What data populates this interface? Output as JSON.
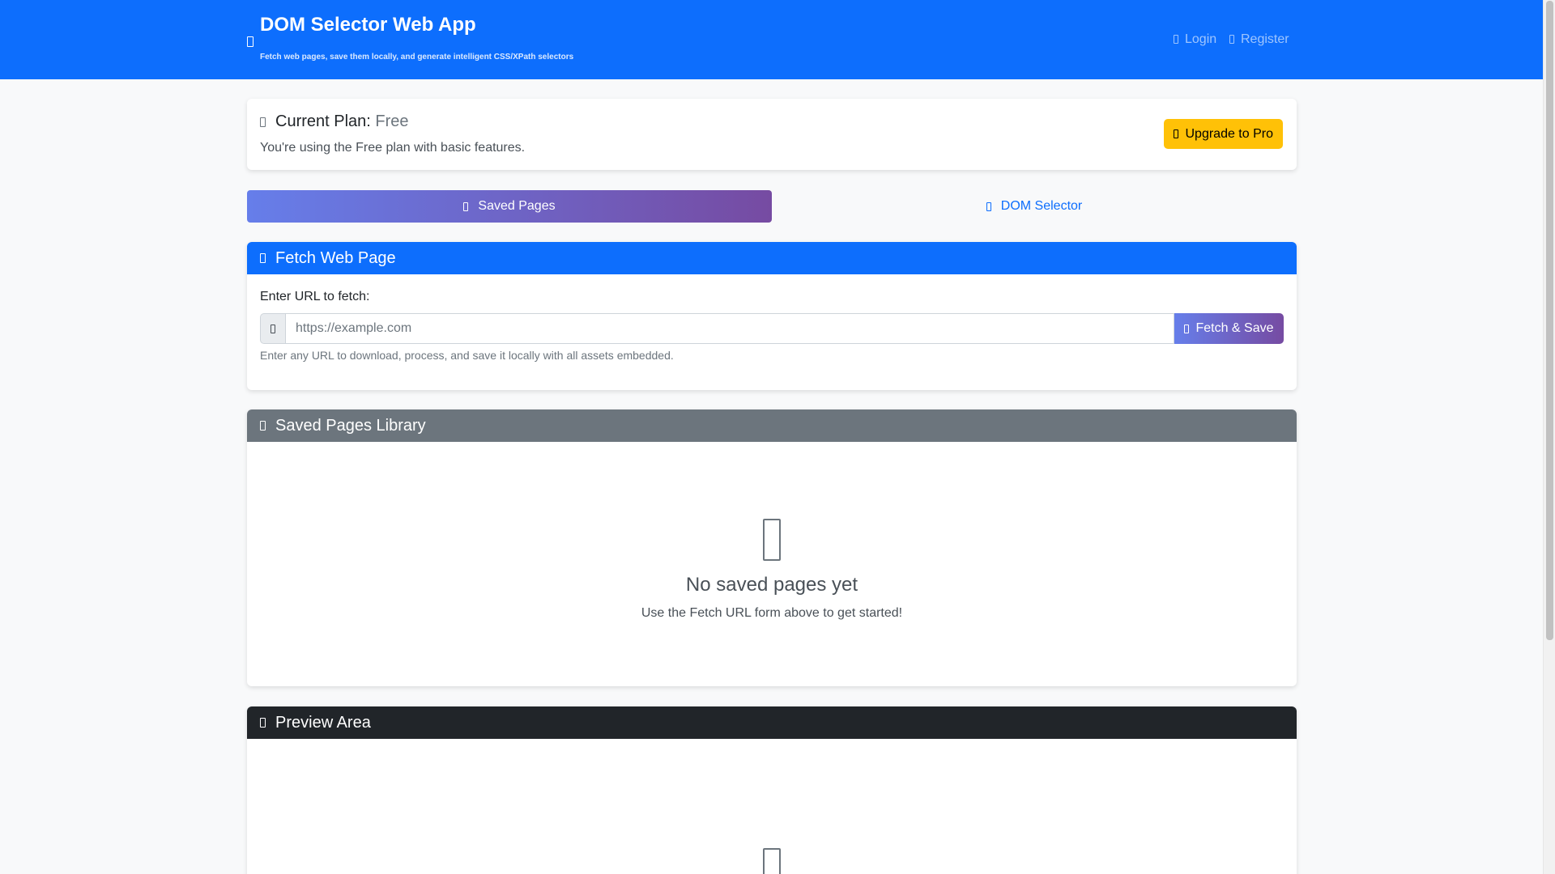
{
  "app": {
    "title": "DOM Selector Web App",
    "subtitle": "Fetch web pages, save them locally, and generate intelligent CSS/XPath selectors",
    "brand_icon": "code-icon"
  },
  "nav": {
    "login": "Login",
    "register": "Register"
  },
  "plan": {
    "label": "Current Plan:",
    "value": "Free",
    "description": "You're using the Free plan with basic features.",
    "upgrade_label": "Upgrade to Pro"
  },
  "tabs": [
    {
      "label": "Saved Pages",
      "active": true,
      "icon": "folder-icon"
    },
    {
      "label": "DOM Selector",
      "active": false,
      "icon": "crosshair-icon"
    }
  ],
  "fetch": {
    "header": "Fetch Web Page",
    "field_label": "Enter URL to fetch:",
    "placeholder": "https://example.com",
    "value": "",
    "button_label": "Fetch & Save",
    "help": "Enter any URL to download, process, and save it locally with all assets embedded."
  },
  "library": {
    "header": "Saved Pages Library",
    "empty_title": "No saved pages yet",
    "empty_subtitle": "Use the Fetch URL form above to get started!"
  },
  "preview": {
    "header": "Preview Area"
  },
  "colors": {
    "primary": "#0d6efd",
    "warning": "#ffc107",
    "secondary": "#6c757d",
    "dark": "#212529",
    "gradient_start": "#667eea",
    "gradient_end": "#764ba2"
  }
}
